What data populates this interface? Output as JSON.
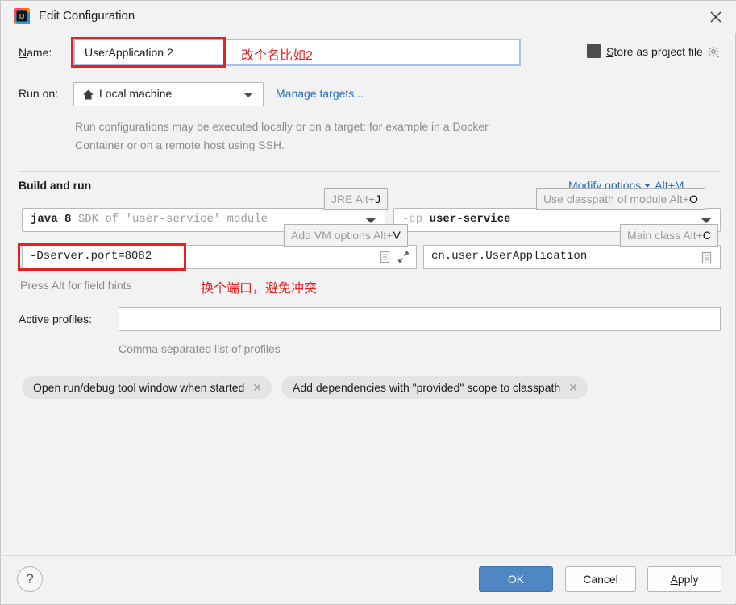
{
  "window": {
    "title": "Edit Configuration",
    "app_icon": "intellij-idea-icon",
    "close_icon": "close-icon"
  },
  "name_row": {
    "label": "Name:",
    "label_mnemonic": "N",
    "value": "UserApplication 2",
    "annotation": "改个名比如2",
    "annotation_color": "#e8201f",
    "store_as_project_file": {
      "label_prefix": "S",
      "label_rest": "tore as project file",
      "checked": true,
      "gear_icon": "gear-icon"
    }
  },
  "run_on": {
    "label": "Run on:",
    "value": "Local machine",
    "value_icon": "home-icon",
    "manage_link": "Manage targets...",
    "description": "Run configurations may be executed locally or on a target: for example in a Docker Container or on a remote host using SSH."
  },
  "build_and_run": {
    "section_title": "Build and run",
    "modify_options": {
      "label": "Modify options",
      "shortcut": "Alt+M",
      "chevron_icon": "chevron-down-icon"
    },
    "jre_combo": {
      "bold_text": "java 8",
      "gray_text": "SDK of 'user-service' module",
      "caret_icon": "chevron-down-icon"
    },
    "classpath_combo": {
      "gray_text": "-cp",
      "bold_text": "user-service",
      "caret_icon": "chevron-down-icon"
    },
    "vm_options": {
      "value": "-Dserver.port=8082",
      "expand_icon": "expand-icon",
      "list_icon": "document-icon",
      "annotation": "换个端口，避免冲突"
    },
    "main_class": {
      "value": "cn.user.UserApplication",
      "list_icon": "document-icon"
    },
    "field_hint": "Press Alt for field hints",
    "tooltips": [
      {
        "name": "jre",
        "text": "JRE Alt+",
        "mnemonic": "J"
      },
      {
        "name": "classpath",
        "text": "Use classpath of module Alt+",
        "mnemonic": "O"
      },
      {
        "name": "vm-options",
        "text": "Add VM options Alt+",
        "mnemonic": "V"
      },
      {
        "name": "main-class",
        "text": "Main class Alt+",
        "mnemonic": "C"
      }
    ]
  },
  "active_profiles": {
    "label": "Active profiles:",
    "value": "",
    "placeholder": "",
    "hint": "Comma separated list of profiles"
  },
  "chips": [
    {
      "label": "Open run/debug tool window when started",
      "close_icon": "close-icon"
    },
    {
      "label": "Add dependencies with \"provided\" scope to classpath",
      "close_icon": "close-icon"
    }
  ],
  "footer": {
    "help_label": "?",
    "ok": "OK",
    "cancel": "Cancel",
    "apply_mnemonic": "A",
    "apply_rest": "pply",
    "ok_color": "#4f87c4"
  }
}
